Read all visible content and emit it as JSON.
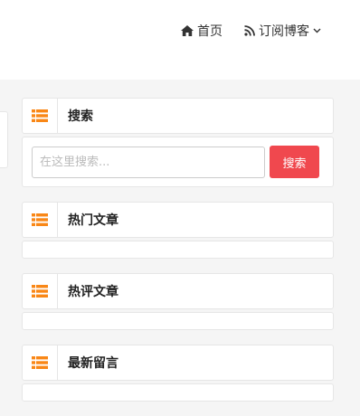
{
  "nav": {
    "home": {
      "label": "首页",
      "icon": "home-icon"
    },
    "subscribe": {
      "label": "订阅博客",
      "icon": "rss-icon",
      "dropdown_icon": "chevron-down-icon"
    }
  },
  "widgets": {
    "search": {
      "title": "搜索",
      "icon": "list-icon",
      "placeholder": "在这里搜索...",
      "button_label": "搜索"
    },
    "hot_articles": {
      "title": "热门文章",
      "icon": "list-icon"
    },
    "hot_comments": {
      "title": "热评文章",
      "icon": "list-icon"
    },
    "latest_messages": {
      "title": "最新留言",
      "icon": "list-icon"
    }
  },
  "colors": {
    "accent_icon": "#f98716",
    "search_button": "#f0484e",
    "background": "#f5f5f5"
  }
}
